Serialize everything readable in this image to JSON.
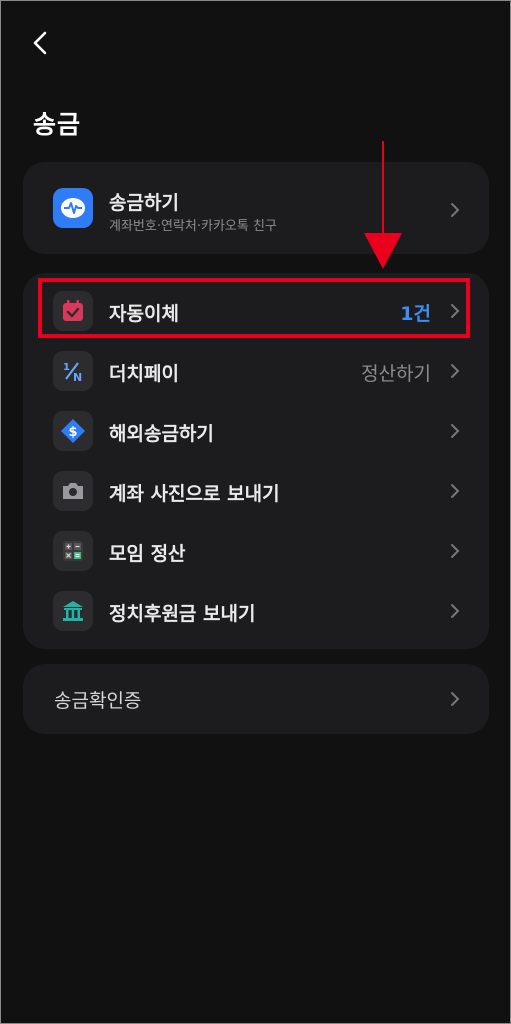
{
  "header": {
    "title": "송금"
  },
  "transfer": {
    "label": "송금하기",
    "sub": "계좌번호·연락처·카카오톡 친구"
  },
  "menu": [
    {
      "label": "자동이체",
      "value": "1건",
      "value_color": "#3d8ff0",
      "icon": "calendar-check-icon"
    },
    {
      "label": "더치페이",
      "value": "정산하기",
      "value_color": "#8c8c8e",
      "icon": "dutch-pay-icon"
    },
    {
      "label": "해외송금하기",
      "value": "",
      "icon": "dollar-diamond-icon"
    },
    {
      "label": "계좌 사진으로 보내기",
      "value": "",
      "icon": "camera-icon"
    },
    {
      "label": "모임 정산",
      "value": "",
      "icon": "calculator-icon"
    },
    {
      "label": "정치후원금 보내기",
      "value": "",
      "icon": "government-building-icon"
    }
  ],
  "confirm": {
    "label": "송금확인증"
  },
  "colors": {
    "highlight": "#e8001c",
    "accent_blue": "#3d8ff0",
    "card": "#1c1c1e"
  }
}
